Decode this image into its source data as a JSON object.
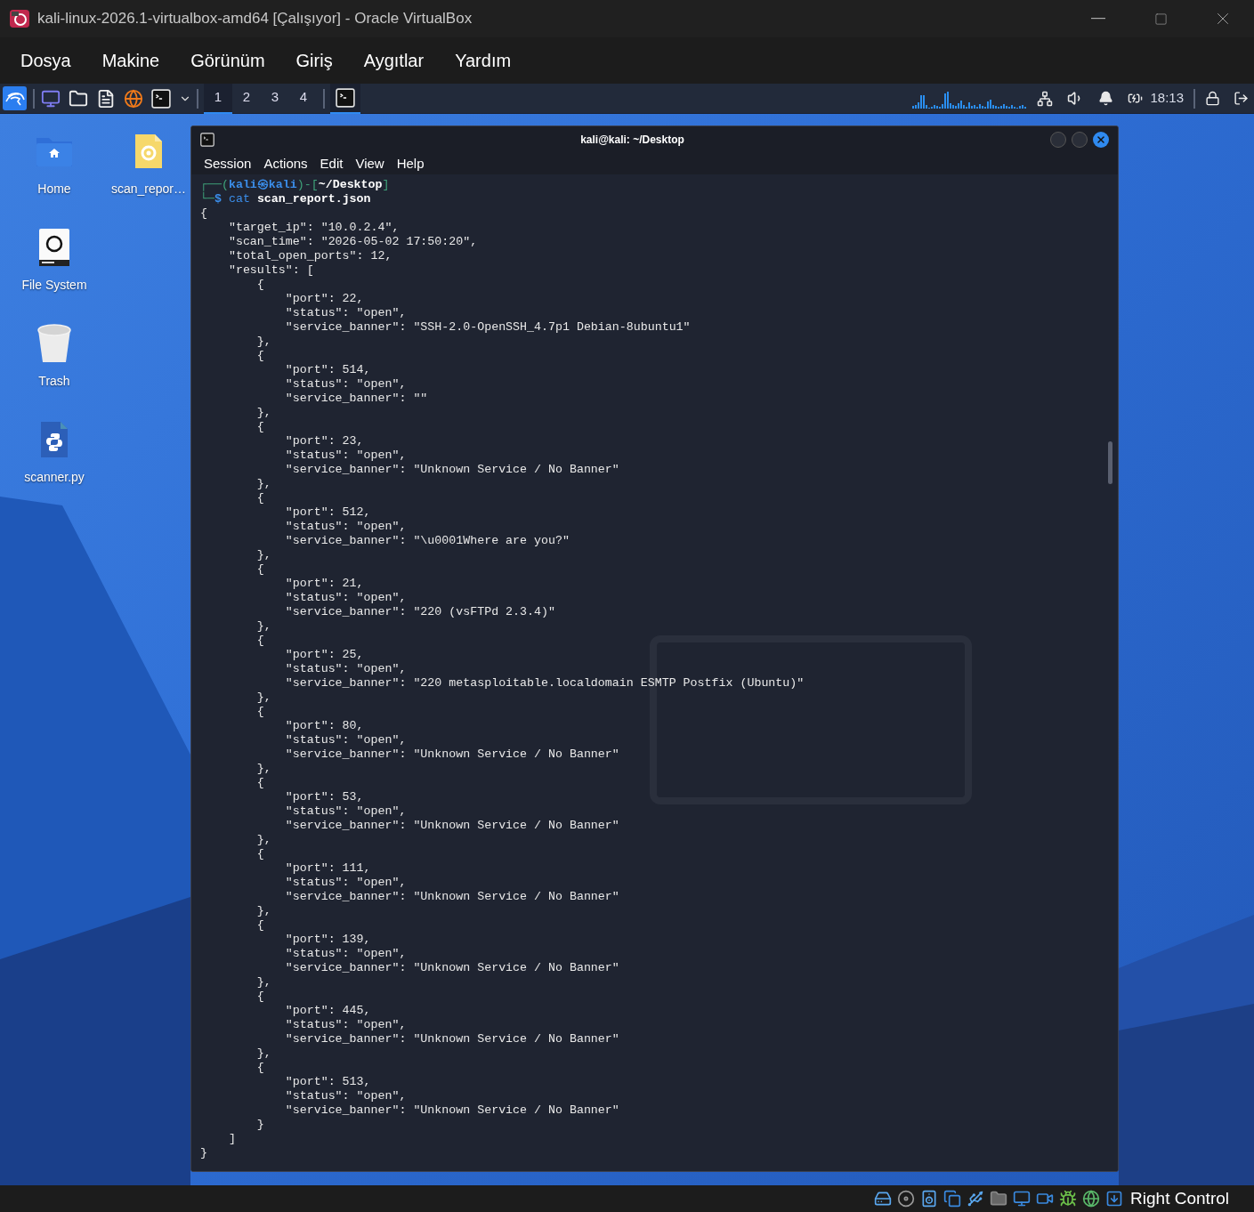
{
  "window": {
    "title": "kali-linux-2026.1-virtualbox-amd64 [Çalışıyor] - Oracle VirtualBox"
  },
  "menubar": [
    "Dosya",
    "Makine",
    "Görünüm",
    "Giriş",
    "Aygıtlar",
    "Yardım"
  ],
  "panel": {
    "workspaces": [
      {
        "label": "1",
        "selected": true
      },
      {
        "label": "2",
        "selected": false
      },
      {
        "label": "3",
        "selected": false
      },
      {
        "label": "4",
        "selected": false
      }
    ],
    "clock": "18:13"
  },
  "desktop_icons": [
    {
      "kind": "home",
      "label": "Home"
    },
    {
      "kind": "document",
      "label": "scan_repor…"
    },
    {
      "kind": "drive",
      "label": "File System"
    },
    {
      "kind": "trash",
      "label": "Trash"
    },
    {
      "kind": "python",
      "label": "scanner.py"
    }
  ],
  "terminal": {
    "title": "kali@kali: ~/Desktop",
    "menu": [
      "Session",
      "Actions",
      "Edit",
      "View",
      "Help"
    ],
    "prompt": {
      "open": "┌──(",
      "user": "kali",
      "at": "㉿",
      "host": "kali",
      "mid": ")-[",
      "path": "~/Desktop",
      "close": "]",
      "corner": "└─",
      "symbol": "$",
      "command": "cat",
      "argument": "scan_report.json"
    },
    "lines": [
      "{",
      "    \"target_ip\": \"10.0.2.4\",",
      "    \"scan_time\": \"2026-05-02 17:50:20\",",
      "    \"total_open_ports\": 12,",
      "    \"results\": [",
      "        {",
      "            \"port\": 22,",
      "            \"status\": \"open\",",
      "            \"service_banner\": \"SSH-2.0-OpenSSH_4.7p1 Debian-8ubuntu1\"",
      "        },",
      "        {",
      "            \"port\": 514,",
      "            \"status\": \"open\",",
      "            \"service_banner\": \"\"",
      "        },",
      "        {",
      "            \"port\": 23,",
      "            \"status\": \"open\",",
      "            \"service_banner\": \"Unknown Service / No Banner\"",
      "        },",
      "        {",
      "            \"port\": 512,",
      "            \"status\": \"open\",",
      "            \"service_banner\": \"\\u0001Where are you?\"",
      "        },",
      "        {",
      "            \"port\": 21,",
      "            \"status\": \"open\",",
      "            \"service_banner\": \"220 (vsFTPd 2.3.4)\"",
      "        },",
      "        {",
      "            \"port\": 25,",
      "            \"status\": \"open\",",
      "            \"service_banner\": \"220 metasploitable.localdomain ESMTP Postfix (Ubuntu)\"",
      "        },",
      "        {",
      "            \"port\": 80,",
      "            \"status\": \"open\",",
      "            \"service_banner\": \"Unknown Service / No Banner\"",
      "        },",
      "        {",
      "            \"port\": 53,",
      "            \"status\": \"open\",",
      "            \"service_banner\": \"Unknown Service / No Banner\"",
      "        },",
      "        {",
      "            \"port\": 111,",
      "            \"status\": \"open\",",
      "            \"service_banner\": \"Unknown Service / No Banner\"",
      "        },",
      "        {",
      "            \"port\": 139,",
      "            \"status\": \"open\",",
      "            \"service_banner\": \"Unknown Service / No Banner\"",
      "        },",
      "        {",
      "            \"port\": 445,",
      "            \"status\": \"open\",",
      "            \"service_banner\": \"Unknown Service / No Banner\"",
      "        },",
      "        {",
      "            \"port\": 513,",
      "            \"status\": \"open\",",
      "            \"service_banner\": \"Unknown Service / No Banner\"",
      "        }",
      "    ]",
      "}"
    ]
  },
  "status_bar": {
    "host_key": "Right Control"
  }
}
